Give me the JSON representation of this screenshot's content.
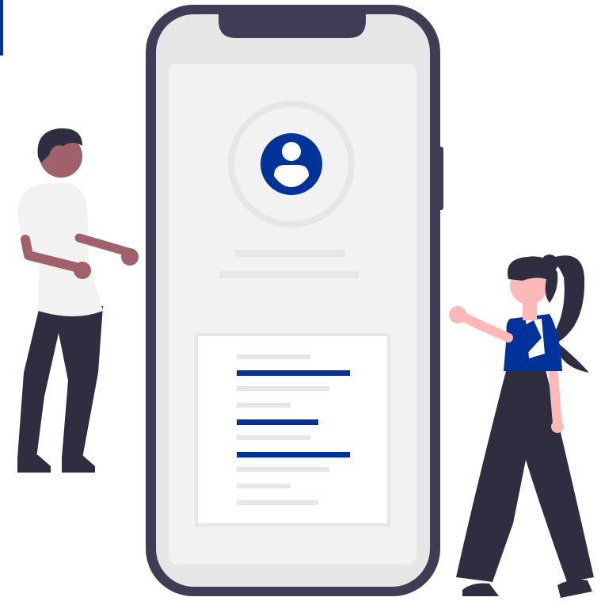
{
  "colors": {
    "accent": "#003399",
    "dark": "#3f3d56",
    "navy": "#2f2e41",
    "screen": "#f2f2f2",
    "placeholder": "#e6e6e6",
    "skin_man": "#a0616a",
    "skin_woman": "#ffb8b8",
    "shirt_man": "#f2f2f2",
    "white": "#ffffff"
  },
  "illustration": {
    "icons": [
      "user-avatar-icon"
    ]
  }
}
